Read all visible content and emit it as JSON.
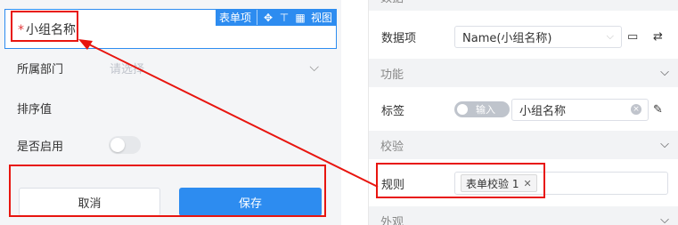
{
  "form": {
    "selected_field": {
      "label": "小组名称",
      "required_mark": "*",
      "toolbar": {
        "tag_label": "表单项",
        "move_icon": "move-icon",
        "top_icon": "align-top-icon",
        "grid_icon": "grid-icon",
        "view_label": "视图"
      }
    },
    "department": {
      "label": "所属部门",
      "placeholder": "请选择"
    },
    "sort": {
      "label": "排序值"
    },
    "enabled": {
      "label": "是否启用"
    },
    "buttons": {
      "cancel": "取消",
      "save": "保存"
    }
  },
  "panel": {
    "sections": {
      "data": "数据",
      "function": "功能",
      "validation": "校验",
      "appearance": "外观"
    },
    "data_item": {
      "label": "数据项",
      "value": "Name(小组名称)"
    },
    "tag_field": {
      "label": "标签",
      "toggle_text": "输入",
      "value": "小组名称"
    },
    "rule": {
      "label": "规则",
      "tag": "表单校验 1"
    }
  },
  "colors": {
    "accent": "#2d8cf0",
    "annotation": "#e8150f",
    "required": "#e4393c"
  }
}
